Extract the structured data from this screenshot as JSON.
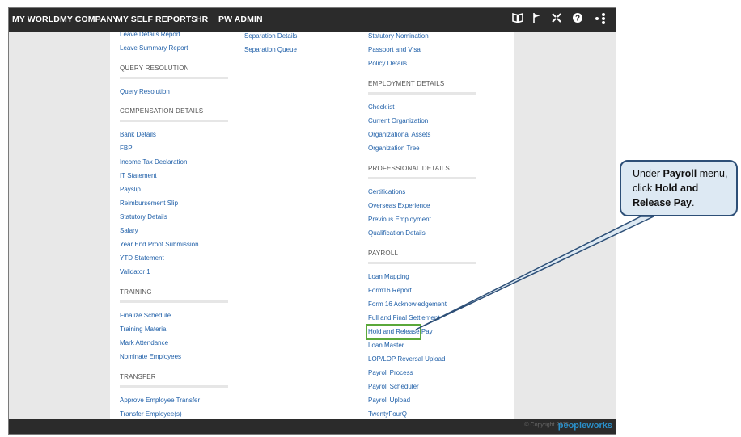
{
  "topnav": {
    "items": [
      "MY WORLD",
      "MY COMPANY",
      "MY SELF",
      "REPORTS",
      "HR",
      "PW ADMIN"
    ]
  },
  "topicons": [
    "book-icon",
    "flag-icon",
    "tools-icon",
    "help-icon",
    "share-icon"
  ],
  "col1": {
    "top_links": [
      "Leave Details Report",
      "Leave Summary Report"
    ],
    "sections": [
      {
        "title": "QUERY RESOLUTION",
        "items": [
          "Query Resolution"
        ]
      },
      {
        "title": "COMPENSATION DETAILS",
        "items": [
          "Bank Details",
          "FBP",
          "Income Tax Declaration",
          "IT Statement",
          "Payslip",
          "Reimbursement Slip",
          "Statutory Details",
          "Salary",
          "Year End Proof Submission",
          "YTD Statement",
          "Validator 1"
        ]
      },
      {
        "title": "TRAINING",
        "items": [
          "Finalize Schedule",
          "Training Material",
          "Mark Attendance",
          "Nominate Employees"
        ]
      },
      {
        "title": "TRANSFER",
        "items": [
          "Approve Employee Transfer",
          "Transfer Employee(s)"
        ]
      }
    ]
  },
  "col2": {
    "top_links": [
      "Separation Details",
      "Separation Queue"
    ]
  },
  "col3": {
    "top_links": [
      "Statutory Nomination",
      "Passport and Visa",
      "Policy Details"
    ],
    "sections": [
      {
        "title": "EMPLOYMENT DETAILS",
        "items": [
          "Checklist",
          "Current Organization",
          "Organizational Assets",
          "Organization Tree"
        ]
      },
      {
        "title": "PROFESSIONAL DETAILS",
        "items": [
          "Certifications",
          "Overseas Experience",
          "Previous Employment",
          "Qualification Details"
        ]
      },
      {
        "title": "PAYROLL",
        "items": [
          "Loan Mapping",
          "Form16 Report",
          "Form 16 Acknowledgement",
          "Full and Final Settlement",
          "Hold and Release Pay",
          "Loan Master",
          "LOP/LOP Reversal Upload",
          "Payroll Process",
          "Payroll Scheduler",
          "Payroll Upload",
          "TwentyFourQ"
        ]
      }
    ]
  },
  "footer": {
    "copyright": "© Copyright 2015",
    "brand": "peopleworks"
  },
  "callout": {
    "pre": "Under ",
    "menu": "Payroll",
    "mid": " menu, click ",
    "target": "Hold and Release Pay",
    "post": "."
  },
  "colors": {
    "bar": "#2b2b2b",
    "link": "#1f5fa8",
    "highlight": "#5aa83a",
    "callout_bg": "#dde9f3",
    "callout_border": "#2d4f77",
    "brand": "#2a8fc9"
  }
}
